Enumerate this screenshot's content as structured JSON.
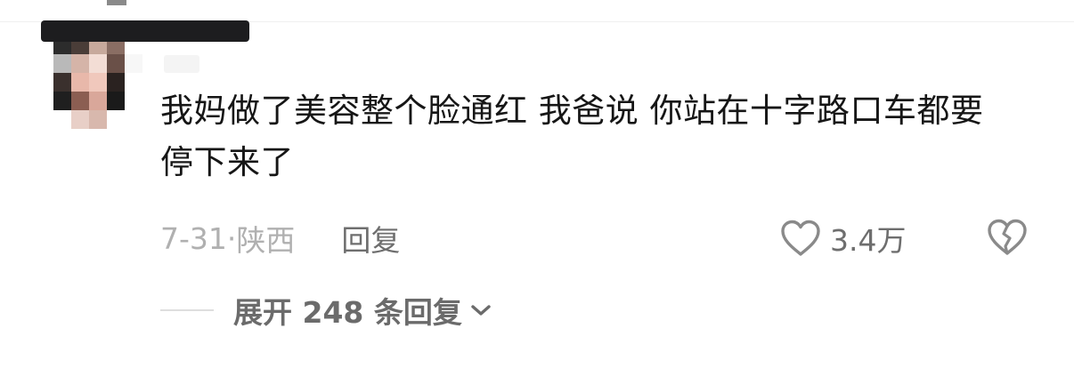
{
  "comment": {
    "text": "我妈做了美容整个脸通红 我爸说 你站在十字路口车都要停下来了",
    "date": "7-31",
    "separator": "·",
    "location": "陕西",
    "reply_label": "回复",
    "like_count": "3.4万"
  },
  "replies": {
    "expand_label": "展开 248 条回复"
  },
  "icons": {
    "like": "heart-outline-icon",
    "dislike": "broken-heart-icon",
    "expand": "chevron-down-icon"
  },
  "colors": {
    "text_primary": "#161616",
    "text_meta": "#b0b0b0",
    "text_secondary": "#6e6e6e"
  }
}
